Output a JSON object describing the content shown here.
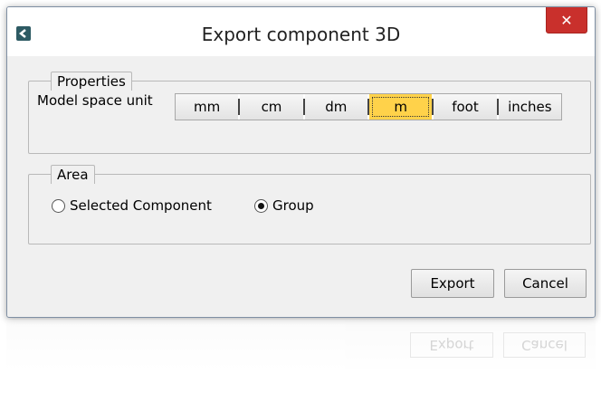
{
  "window": {
    "title": "Export component 3D",
    "close_label": "✕"
  },
  "properties": {
    "legend": "Properties",
    "unit_label": "Model space unit",
    "units": [
      "mm",
      "cm",
      "dm",
      "m",
      "foot",
      "inches"
    ],
    "selected_unit": "m"
  },
  "area": {
    "legend": "Area",
    "options": [
      "Selected Component",
      "Group"
    ],
    "selected": "Group"
  },
  "buttons": {
    "export_label": "Export",
    "cancel_label": "Cancel"
  },
  "colors": {
    "accent_selected": "#ffd24a",
    "close_button": "#c9302c"
  },
  "icons": {
    "app": "back-arrow-icon",
    "close": "close-icon"
  }
}
